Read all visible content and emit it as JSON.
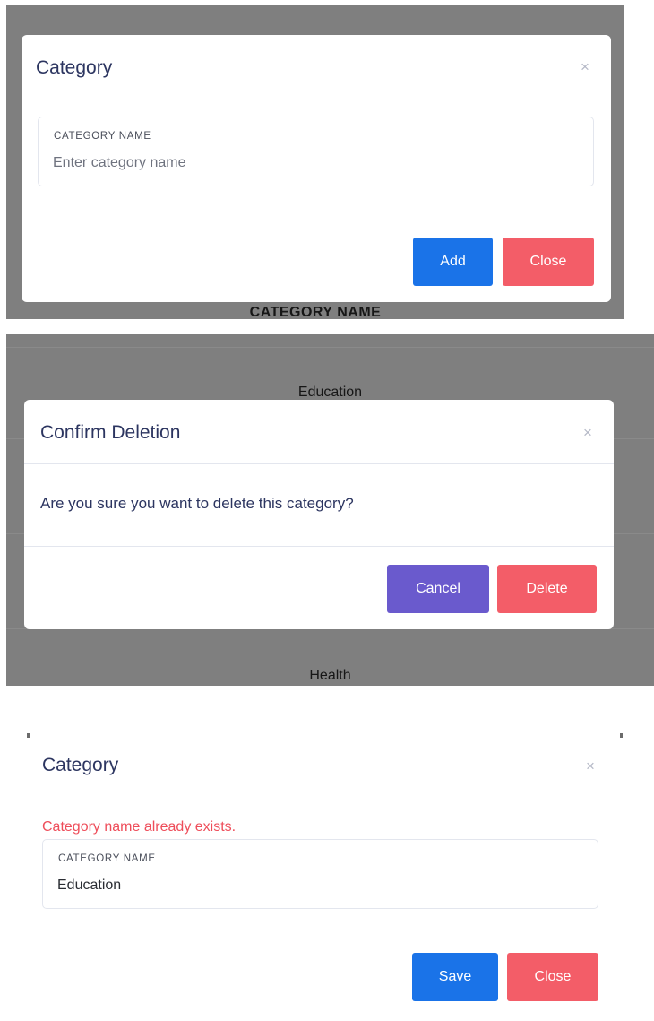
{
  "panel1": {
    "background_text": "CATEGORY NAME",
    "modal": {
      "title": "Category",
      "close_glyph": "×",
      "field": {
        "label": "CATEGORY NAME",
        "value": "",
        "placeholder": "Enter category name"
      },
      "add_label": "Add",
      "close_label": "Close"
    }
  },
  "panel2": {
    "background_rows": [
      "Education",
      "Health"
    ],
    "modal": {
      "title": "Confirm Deletion",
      "close_glyph": "×",
      "message": "Are you sure you want to delete this category?",
      "cancel_label": "Cancel",
      "delete_label": "Delete"
    }
  },
  "panel3": {
    "modal": {
      "title": "Category",
      "close_glyph": "×",
      "error": "Category name already exists.",
      "field": {
        "label": "CATEGORY NAME",
        "value": "Education",
        "placeholder": ""
      },
      "save_label": "Save",
      "close_label": "Close"
    }
  },
  "colors": {
    "primary": "#1a73e8",
    "danger": "#f35d68",
    "cancel": "#6a5acd",
    "title": "#2c3560",
    "error": "#ee4d5a",
    "backdrop": "#7f7f7f"
  },
  "icons": {
    "close": "close-icon"
  }
}
